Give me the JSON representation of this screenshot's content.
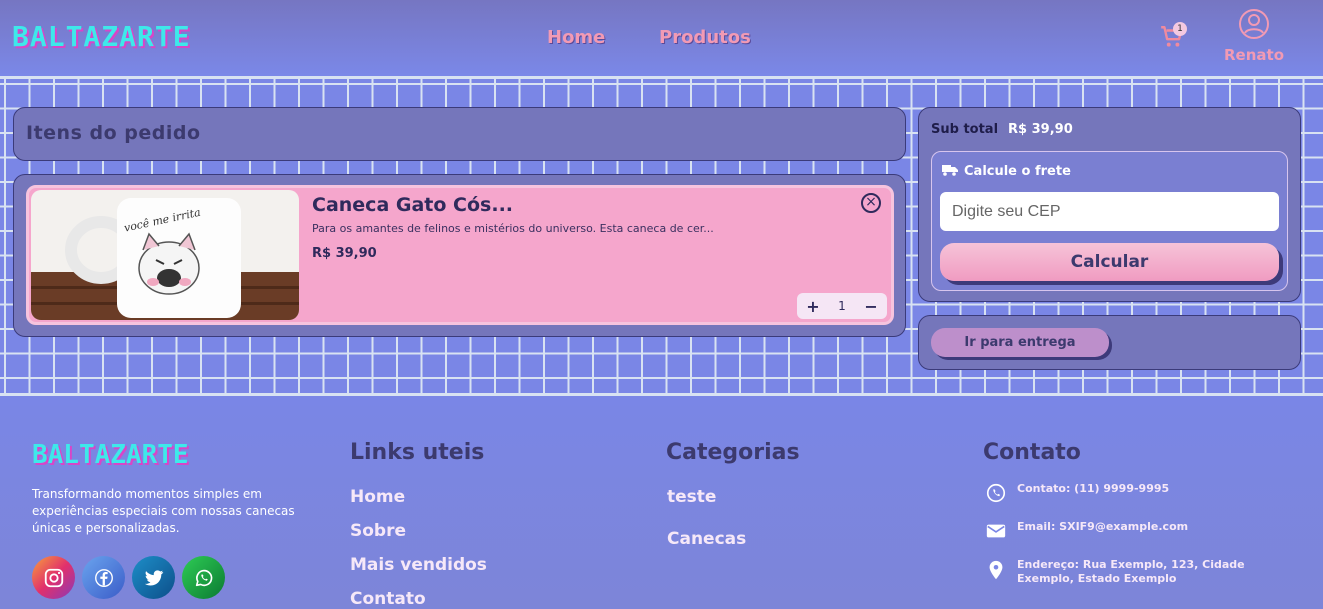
{
  "header": {
    "brand": "BALTAZARTE",
    "nav": [
      {
        "label": "Home"
      },
      {
        "label": "Produtos"
      }
    ],
    "cart_count": "1",
    "user_name": "Renato"
  },
  "order": {
    "title": "Itens do pedido",
    "items": [
      {
        "name": "Caneca Gato Cós...",
        "description": "Para os amantes de felinos e mistérios do universo. Esta caneca de cer...",
        "price": "R$ 39,90",
        "quantity": "1",
        "image_caption": "você me irrita"
      }
    ]
  },
  "summary": {
    "subtotal_label": "Sub total",
    "subtotal_value": "R$ 39,90",
    "freight_title": "Calcule o frete",
    "cep_placeholder": "Digite seu CEP",
    "calc_button": "Calcular",
    "delivery_button": "Ir para entrega"
  },
  "footer": {
    "brand": "BALTAZARTE",
    "tagline": "Transformando momentos simples em experiências especiais com nossas canecas únicas e personalizadas.",
    "links_title": "Links uteis",
    "links": [
      "Home",
      "Sobre",
      "Mais vendidos",
      "Contato"
    ],
    "categories_title": "Categorias",
    "categories": [
      "teste",
      "Canecas"
    ],
    "contact_title": "Contato",
    "contact_phone": "Contato: (11) 9999-9995",
    "contact_email": "Email: SXIF9@example.com",
    "contact_address": "Endereço: Rua Exemplo, 123, Cidade Exemplo, Estado Exemplo"
  },
  "colors": {
    "accent_pink": "#f29ab4",
    "brand_cyan": "#3ee8ea",
    "panel": "#7576bb",
    "background": "#7a86e6"
  },
  "icons": [
    "cart-icon",
    "user-icon",
    "truck-icon",
    "close-circle-icon",
    "plus-icon",
    "minus-icon",
    "instagram-icon",
    "facebook-icon",
    "twitter-icon",
    "whatsapp-icon",
    "phone-icon",
    "mail-icon",
    "location-icon"
  ]
}
